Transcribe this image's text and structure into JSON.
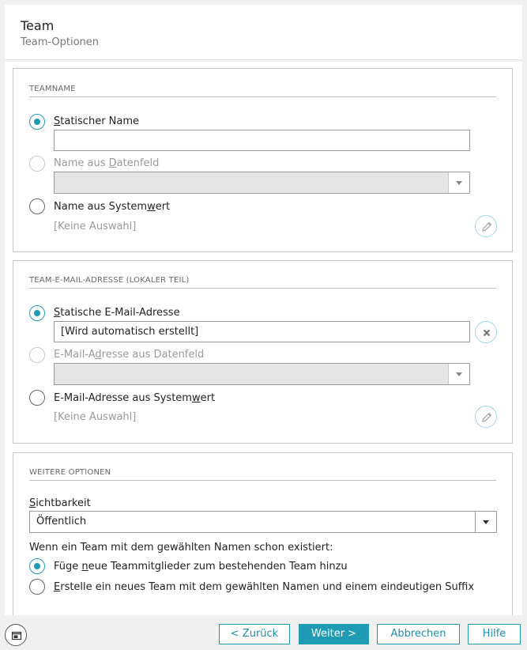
{
  "header": {
    "title": "Team",
    "subtitle": "Team-Optionen"
  },
  "teamname": {
    "section_title": "TEAMNAME",
    "static_pre": "",
    "static_key": "S",
    "static_post": "tatischer Name",
    "static_value": "",
    "field_pre": "Name aus ",
    "field_key": "D",
    "field_post": "atenfeld",
    "system_pre": "Name aus System",
    "system_key": "w",
    "system_post": "ert",
    "system_value": "[Keine Auswahl]"
  },
  "email": {
    "section_title": "TEAM-E-MAIL-ADRESSE (LOKALER TEIL)",
    "static_pre": "",
    "static_key": "S",
    "static_post": "tatische E-Mail-Adresse",
    "static_value": "[Wird automatisch erstellt]",
    "field_pre": "E-Mail-A",
    "field_key": "d",
    "field_post": "resse aus Datenfeld",
    "system_pre": "E-Mail-Adresse aus System",
    "system_key": "w",
    "system_post": "ert",
    "system_value": "[Keine Auswahl]"
  },
  "options": {
    "section_title": "WEITERE OPTIONEN",
    "visibility_key": "S",
    "visibility_post": "ichtbarkeit",
    "visibility_value": "Öffentlich",
    "exists_text": "Wenn ein Team mit dem gewählten Namen schon existiert:",
    "opt1_pre": "Füge ",
    "opt1_key": "n",
    "opt1_post": "eue Teammitglieder zum bestehenden Team hinzu",
    "opt2_pre": "",
    "opt2_key": "E",
    "opt2_post": "rstelle ein neues Team mit dem gewählten Namen und einem eindeutigen Suffix"
  },
  "footer": {
    "back": "< Zurück",
    "next": "Weiter >",
    "cancel": "Abbrechen",
    "help": "Hilfe"
  },
  "colors": {
    "accent": "#1f9bb3"
  },
  "icons": [
    "pencil-icon",
    "clear-icon",
    "window-icon",
    "chevron-down-icon"
  ]
}
